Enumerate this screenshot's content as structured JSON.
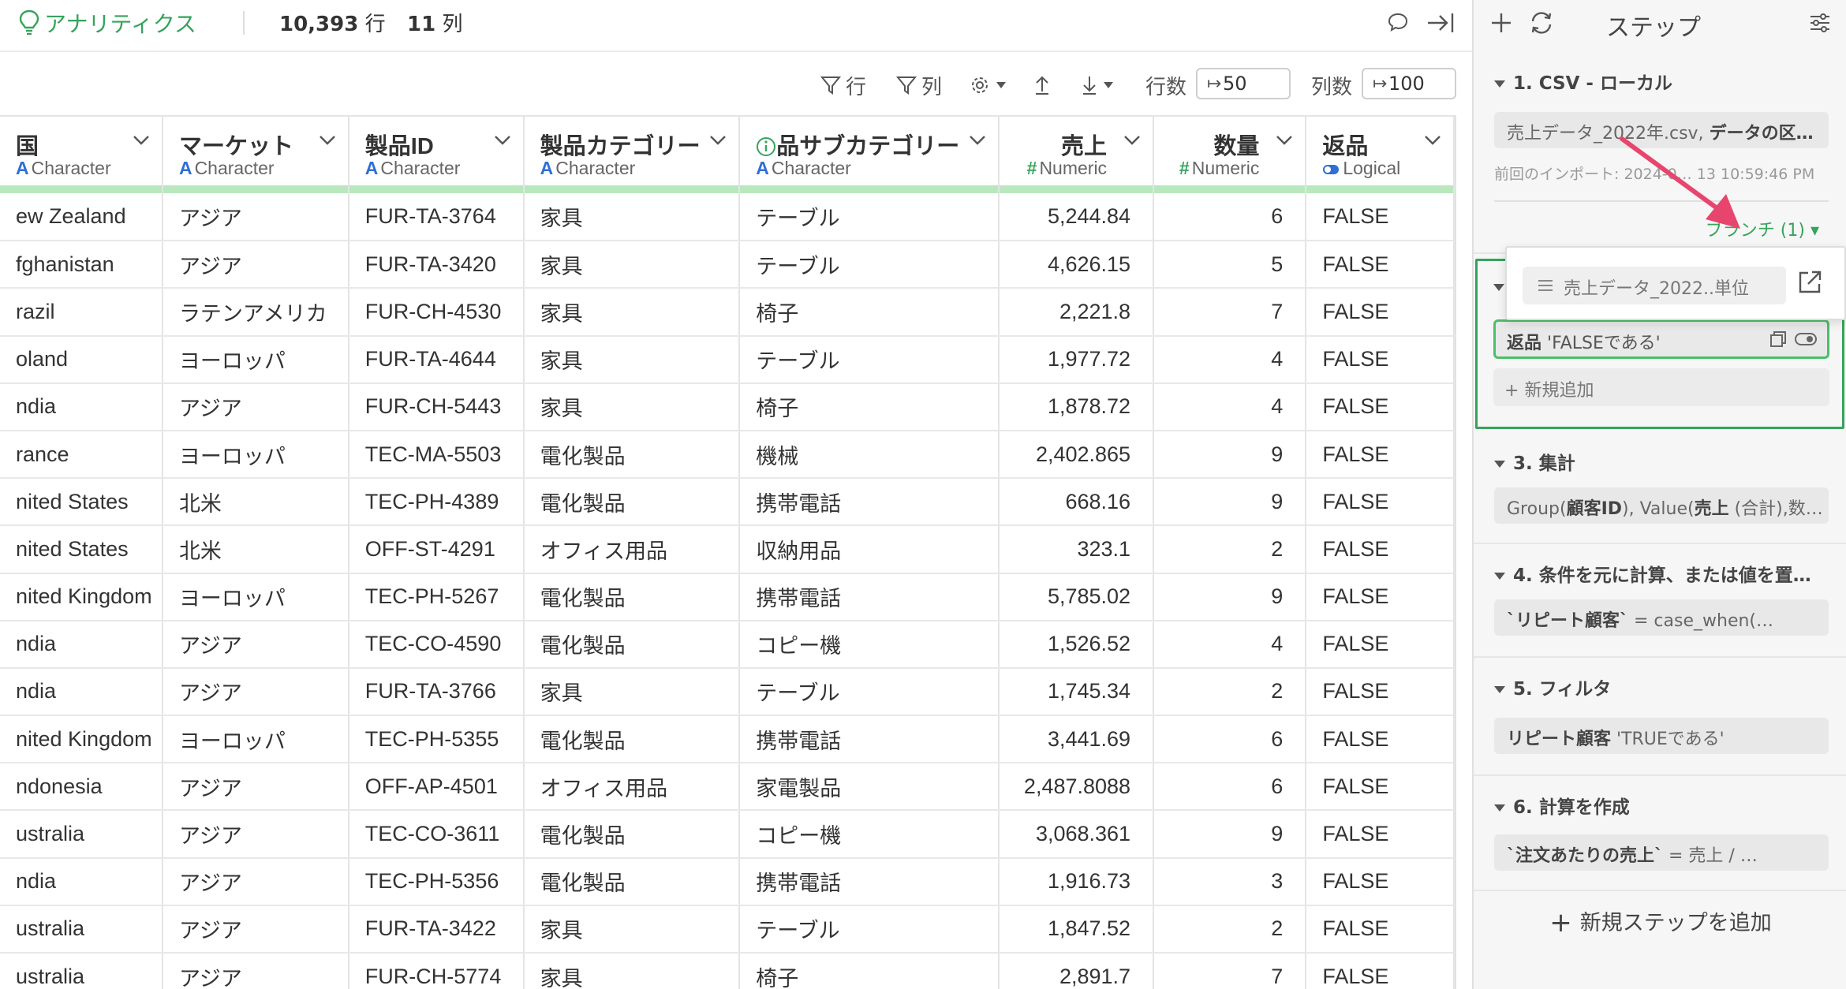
{
  "topbar": {
    "analytics_label": "アナリティクス",
    "row_count": "10,393",
    "row_unit": "行",
    "col_count": "11",
    "col_unit": "列"
  },
  "toolbar": {
    "filter_rows_label": "行",
    "filter_cols_label": "列",
    "rows_label": "行数",
    "rows_value": "50",
    "cols_label": "列数",
    "cols_value": "100"
  },
  "table": {
    "columns": [
      {
        "name": "国",
        "type": "Character",
        "type_icon": "A"
      },
      {
        "name": "マーケット",
        "type": "Character",
        "type_icon": "A"
      },
      {
        "name": "製品ID",
        "type": "Character",
        "type_icon": "A"
      },
      {
        "name": "製品カテゴリー",
        "type": "Character",
        "type_icon": "A"
      },
      {
        "name": "品サブカテゴリー",
        "type": "Character",
        "type_icon": "A"
      },
      {
        "name": "売上",
        "type": "Numeric",
        "type_icon": "#"
      },
      {
        "name": "数量",
        "type": "Numeric",
        "type_icon": "#"
      },
      {
        "name": "返品",
        "type": "Logical",
        "type_icon": "toggle"
      }
    ],
    "rows": [
      [
        "ew Zealand",
        "アジア",
        "FUR-TA-3764",
        "家具",
        "テーブル",
        "5,244.84",
        "6",
        "FALSE"
      ],
      [
        "fghanistan",
        "アジア",
        "FUR-TA-3420",
        "家具",
        "テーブル",
        "4,626.15",
        "5",
        "FALSE"
      ],
      [
        "razil",
        "ラテンアメリカ",
        "FUR-CH-4530",
        "家具",
        "椅子",
        "2,221.8",
        "7",
        "FALSE"
      ],
      [
        "oland",
        "ヨーロッパ",
        "FUR-TA-4644",
        "家具",
        "テーブル",
        "1,977.72",
        "4",
        "FALSE"
      ],
      [
        "ndia",
        "アジア",
        "FUR-CH-5443",
        "家具",
        "椅子",
        "1,878.72",
        "4",
        "FALSE"
      ],
      [
        "rance",
        "ヨーロッパ",
        "TEC-MA-5503",
        "電化製品",
        "機械",
        "2,402.865",
        "9",
        "FALSE"
      ],
      [
        "nited States",
        "北米",
        "TEC-PH-4389",
        "電化製品",
        "携帯電話",
        "668.16",
        "9",
        "FALSE"
      ],
      [
        "nited States",
        "北米",
        "OFF-ST-4291",
        "オフィス用品",
        "収納用品",
        "323.1",
        "2",
        "FALSE"
      ],
      [
        "nited Kingdom",
        "ヨーロッパ",
        "TEC-PH-5267",
        "電化製品",
        "携帯電話",
        "5,785.02",
        "9",
        "FALSE"
      ],
      [
        "ndia",
        "アジア",
        "TEC-CO-4590",
        "電化製品",
        "コピー機",
        "1,526.52",
        "4",
        "FALSE"
      ],
      [
        "ndia",
        "アジア",
        "FUR-TA-3766",
        "家具",
        "テーブル",
        "1,745.34",
        "2",
        "FALSE"
      ],
      [
        "nited Kingdom",
        "ヨーロッパ",
        "TEC-PH-5355",
        "電化製品",
        "携帯電話",
        "3,441.69",
        "6",
        "FALSE"
      ],
      [
        "ndonesia",
        "アジア",
        "OFF-AP-4501",
        "オフィス用品",
        "家電製品",
        "2,487.8088",
        "6",
        "FALSE"
      ],
      [
        "ustralia",
        "アジア",
        "TEC-CO-3611",
        "電化製品",
        "コピー機",
        "3,068.361",
        "9",
        "FALSE"
      ],
      [
        "ndia",
        "アジア",
        "TEC-PH-5356",
        "電化製品",
        "携帯電話",
        "1,916.73",
        "3",
        "FALSE"
      ],
      [
        "ustralia",
        "アジア",
        "FUR-TA-3422",
        "家具",
        "テーブル",
        "1,847.52",
        "2",
        "FALSE"
      ],
      [
        "ustralia",
        "アジア",
        "FUR-CH-5774",
        "家具",
        "椅子",
        "2,891.7",
        "7",
        "FALSE"
      ]
    ]
  },
  "panel": {
    "title": "ステップ",
    "step1": {
      "title": "1. CSV - ローカル",
      "file_name": "売上データ_2022年.csv,",
      "file_rest": "データの区…",
      "meta": "前回のインポート: 2024-0… 13 10:59:46 PM",
      "branch": "ブランチ (1)"
    },
    "branch_popup": {
      "item": "売上データ_2022..単位"
    },
    "step2": {
      "cond_col": "返品",
      "cond_rest": "'FALSEである'",
      "add": "新規追加"
    },
    "step3": {
      "title": "3. 集計",
      "group": "Group(",
      "g_bold": "顧客ID",
      "mid": "), Value(",
      "v_bold": "売上",
      "tail": " (合計),数…"
    },
    "step4": {
      "title": "4. 条件を元に計算、または値を置…",
      "bold": "`リピート顧客`",
      "rest": " = case_when(…"
    },
    "step5": {
      "title": "5. フィルタ",
      "bold": "リピート顧客",
      "rest": " 'TRUEである'"
    },
    "step6": {
      "title": "6. 計算を作成",
      "bold": "`注文あたりの売上`",
      "rest": " = 売上 / …"
    },
    "add_step": "新規ステップを追加"
  },
  "colors": {
    "accent": "#36a35c",
    "arrow": "#e8456e",
    "type_char": "#2f6fd6"
  }
}
